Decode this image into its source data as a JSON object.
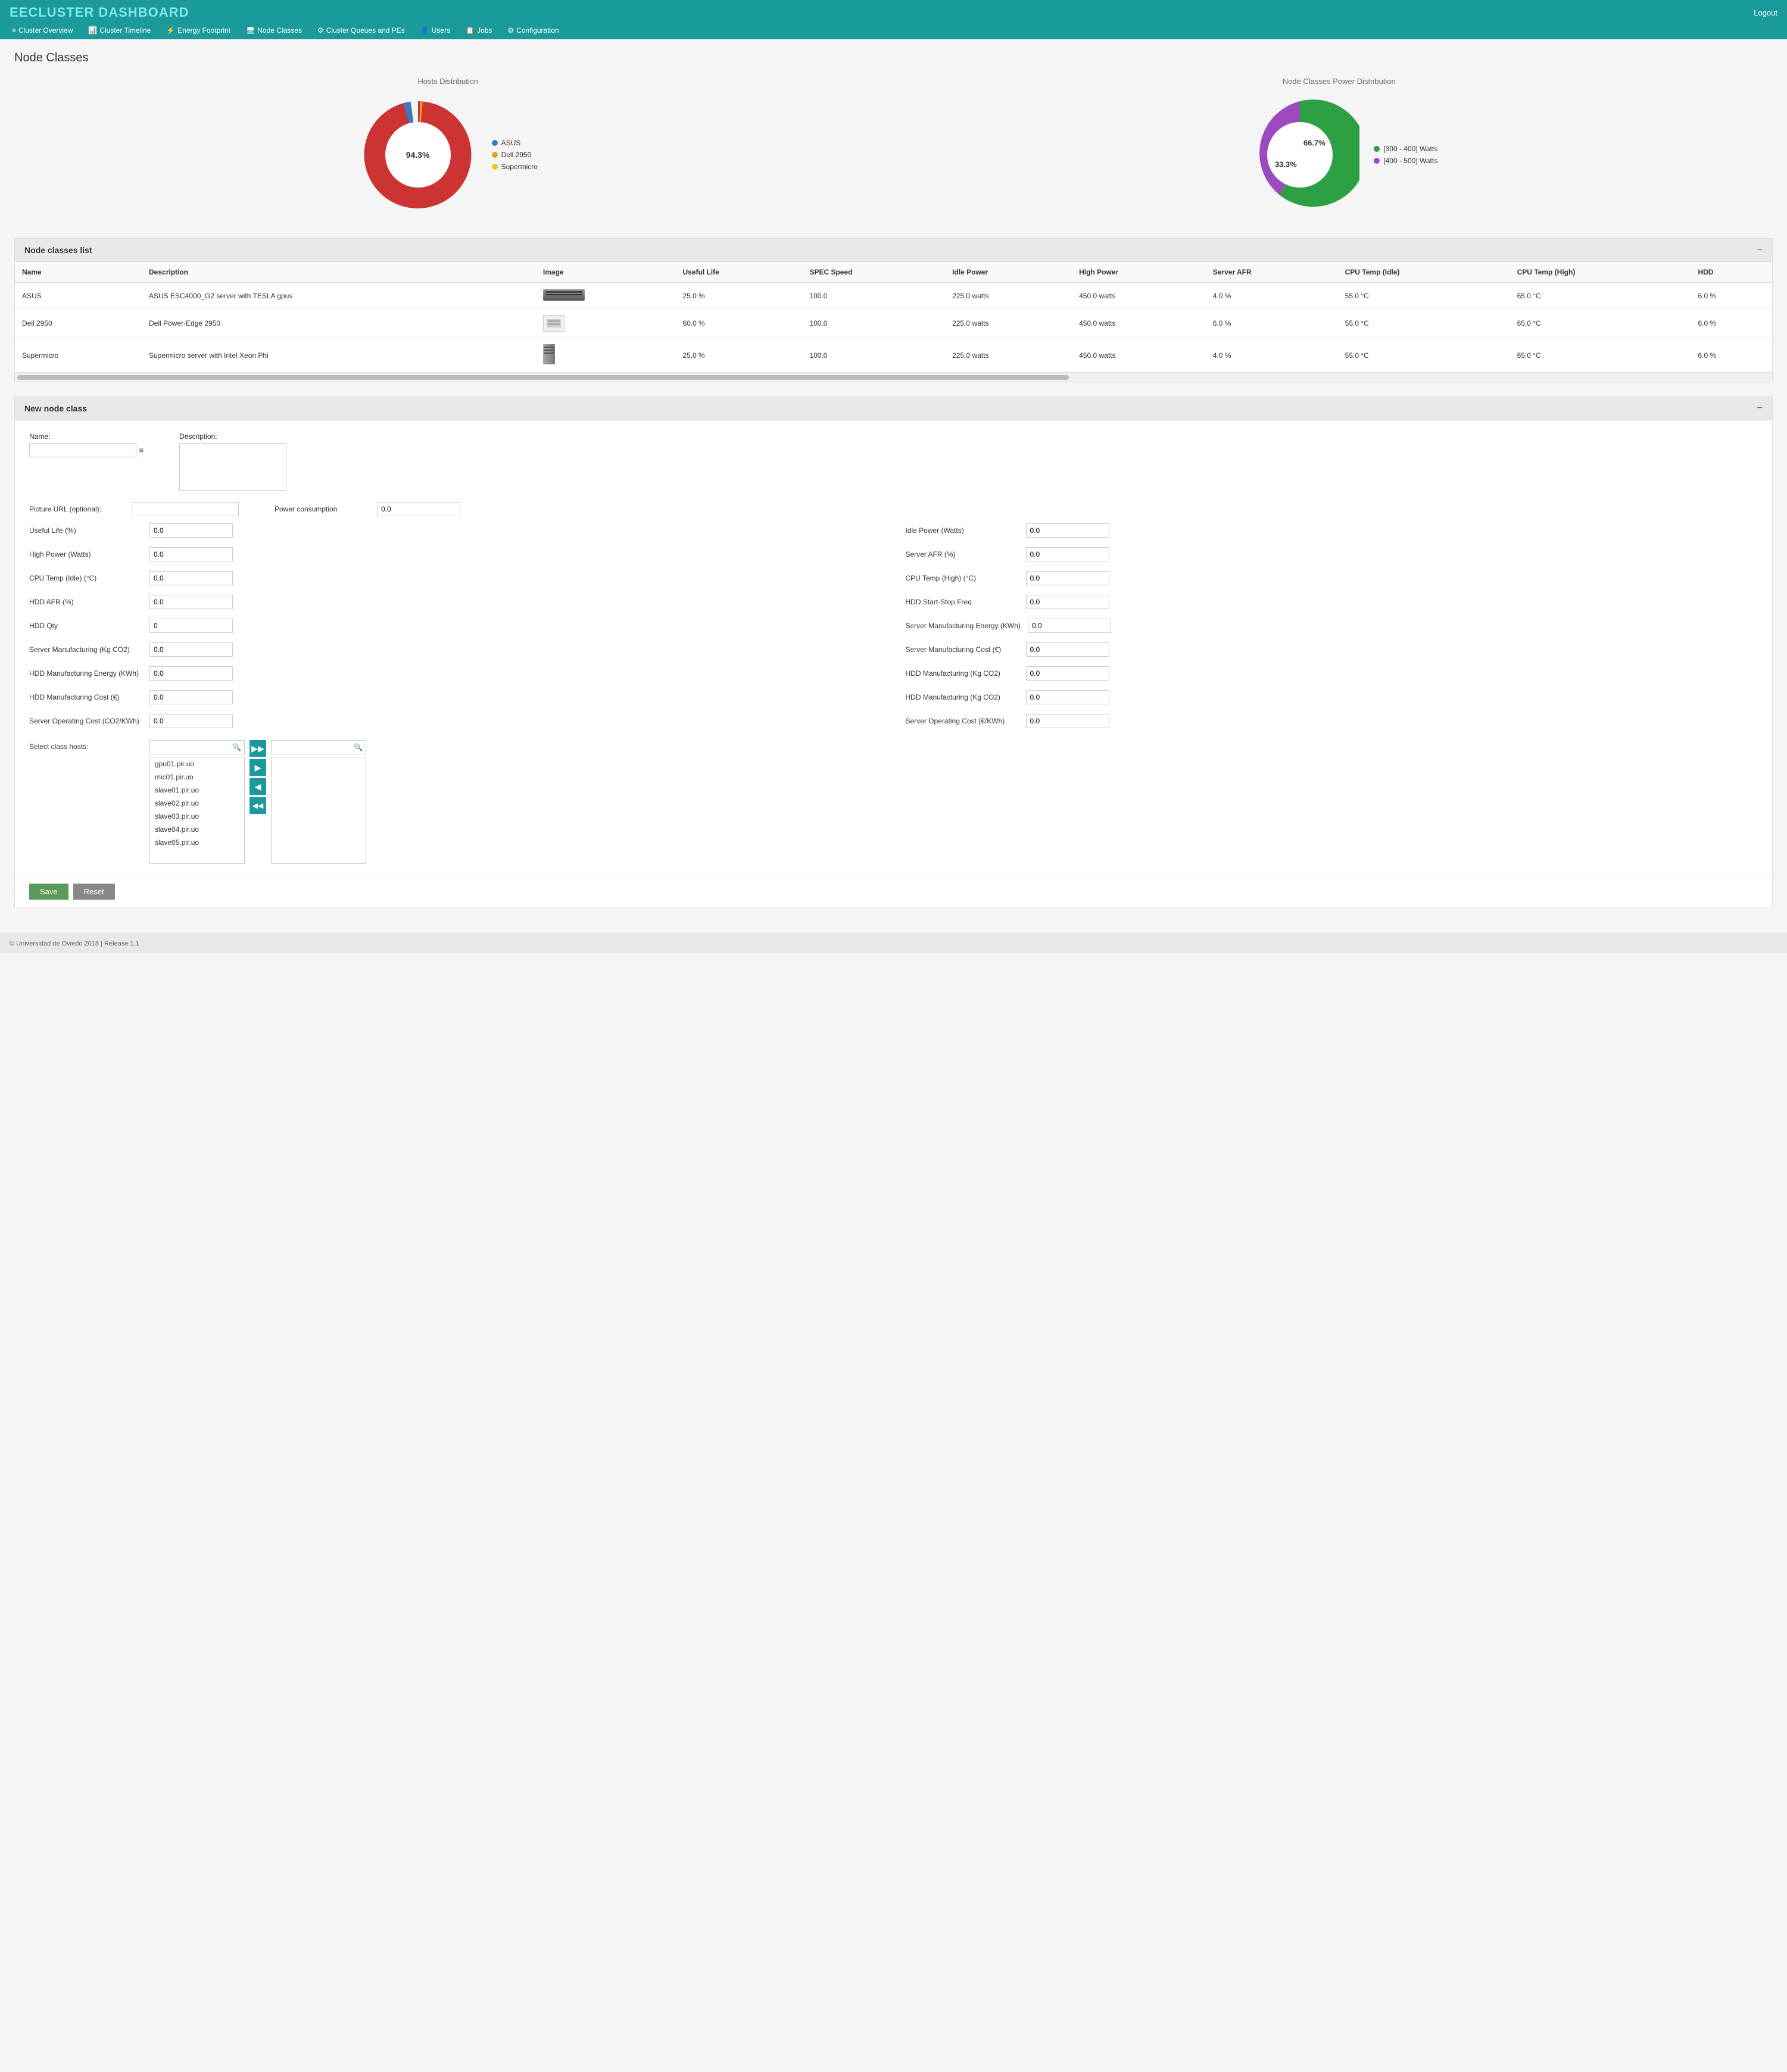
{
  "app": {
    "title_prefix": "EE",
    "title_main": "CLUSTER DASHBOARD",
    "logout_label": "Logout"
  },
  "nav": {
    "items": [
      {
        "id": "cluster-overview",
        "icon": "≡",
        "label": "Cluster Overview"
      },
      {
        "id": "cluster-timeline",
        "icon": "📊",
        "label": "Cluster Timeline"
      },
      {
        "id": "energy-footprint",
        "icon": "⚡",
        "label": "Energy Footprint"
      },
      {
        "id": "node-classes",
        "icon": "🖥",
        "label": "Node Classes"
      },
      {
        "id": "cluster-queues",
        "icon": "⚙",
        "label": "Cluster Queues and PEs"
      },
      {
        "id": "users",
        "icon": "👤",
        "label": "Users"
      },
      {
        "id": "jobs",
        "icon": "📋",
        "label": "Jobs"
      },
      {
        "id": "configuration",
        "icon": "⚙",
        "label": "Configuration"
      }
    ]
  },
  "page": {
    "title": "Node Classes"
  },
  "hosts_chart": {
    "title": "Hosts Distribution",
    "legend": [
      {
        "label": "ASUS",
        "color": "#3a7abf"
      },
      {
        "label": "Dell 2950",
        "color": "#e8a020"
      },
      {
        "label": "Supermicro",
        "color": "#e8c820"
      }
    ],
    "slices": [
      {
        "label": "ASUS",
        "percent": 94.3,
        "color": "#cc3333",
        "startAngle": 0,
        "endAngle": 339.48
      },
      {
        "label": "Dell 2950",
        "percent": 3.7,
        "color": "#3a7abf",
        "startAngle": 339.48,
        "endAngle": 352.8
      },
      {
        "label": "Supermicro",
        "percent": 2.0,
        "color": "#e8a020",
        "startAngle": 352.8,
        "endAngle": 360
      }
    ],
    "center_label": "94.3%"
  },
  "power_chart": {
    "title": "Node Classes Power Distribution",
    "legend": [
      {
        "label": "[300 - 400] Watts",
        "color": "#2da044"
      },
      {
        "label": "[400 - 500] Watts",
        "color": "#9b4ac0"
      }
    ],
    "slices": [
      {
        "label": "[300-400]",
        "percent": 66.7,
        "color": "#2da044"
      },
      {
        "label": "[400-500]",
        "percent": 33.3,
        "color": "#9b4ac0"
      }
    ],
    "label_300": "66.7%",
    "label_400": "33.3%"
  },
  "node_classes_table": {
    "section_title": "Node classes list",
    "collapse_icon": "−",
    "columns": [
      "Name",
      "Description",
      "Image",
      "Useful Life",
      "SPEC Speed",
      "Idle Power",
      "High Power",
      "Server AFR",
      "CPU Temp (Idle)",
      "CPU Temp (High)",
      "HDD"
    ],
    "rows": [
      {
        "name": "ASUS",
        "description": "ASUS ESC4000_G2 server with TESLA gpus",
        "image_type": "rack",
        "useful_life": "25.0 %",
        "spec_speed": "100.0",
        "idle_power": "225.0 watts",
        "high_power": "450.0 watts",
        "server_afr": "4.0 %",
        "cpu_temp_idle": "55.0 °C",
        "cpu_temp_high": "65.0 °C",
        "hdd": "6.0 %"
      },
      {
        "name": "Dell 2950",
        "description": "Dell Power-Edge 2950",
        "image_type": "small",
        "useful_life": "60.0 %",
        "spec_speed": "100.0",
        "idle_power": "225.0 watts",
        "high_power": "450.0 watts",
        "server_afr": "6.0 %",
        "cpu_temp_idle": "55.0 °C",
        "cpu_temp_high": "65.0 °C",
        "hdd": "6.0 %"
      },
      {
        "name": "Supermicro",
        "description": "Supermicro server with Intel Xeon Phi",
        "image_type": "tower",
        "useful_life": "25.0 %",
        "spec_speed": "100.0",
        "idle_power": "225.0 watts",
        "high_power": "450.0 watts",
        "server_afr": "4.0 %",
        "cpu_temp_idle": "55.0 °C",
        "cpu_temp_high": "65.0 °C",
        "hdd": "6.0 %"
      }
    ]
  },
  "new_node_class": {
    "section_title": "New node class",
    "collapse_icon": "−",
    "fields": {
      "name_label": "Name:",
      "description_label": "Description:",
      "picture_url_label": "Picture URL (optional):",
      "power_consumption_label": "Power consumption",
      "useful_life_label": "Useful Life (%)",
      "idle_power_label": "Idle Power (Watts)",
      "high_power_label": "High Power (Watts)",
      "server_afr_label": "Server AFR (%)",
      "cpu_temp_idle_label": "CPU Temp (Idle) (°C)",
      "cpu_temp_high_label": "CPU Temp (High) (°C)",
      "hdd_afr_label": "HDD AFR (%)",
      "hdd_start_stop_label": "HDD Start-Stop Freq",
      "hdd_qty_label": "HDD Qty",
      "server_mfg_energy_label": "Server Manufacturing Energy (KWh)",
      "server_mfg_co2_label": "Server Manufacturing (Kg CO2)",
      "server_mfg_cost_label": "Server Manufacturing Cost (€)",
      "hdd_mfg_energy_label": "HDD Manufacturing Energy (KWh)",
      "hdd_mfg_co2_label": "HDD Manufacturing (Kg CO2)",
      "hdd_mfg_cost_label": "HDD Manufacturing Cost (€)",
      "hdd_mfg_co2_right_label": "HDD Manufacturing (Kg CO2)",
      "server_op_cost_label": "Server Operating Cost (CO2/KWh)",
      "server_op_cost_right_label": "Server Operating Cost (€/KWh)",
      "select_hosts_label": "Select class hosts:",
      "name_value": "",
      "description_value": "",
      "picture_url_value": "",
      "power_consumption_value": "0.0",
      "useful_life_value": "0.0",
      "idle_power_value": "0.0",
      "high_power_value": "0.0",
      "server_afr_value": "0.0",
      "cpu_temp_idle_value": "0.0",
      "cpu_temp_high_value": "0.0",
      "hdd_afr_value": "0.0",
      "hdd_start_stop_value": "0.0",
      "hdd_qty_value": "0",
      "server_mfg_energy_value": "0.0",
      "server_mfg_co2_value": "0.0",
      "server_mfg_cost_value": "0.0",
      "hdd_mfg_energy_value": "0.0",
      "hdd_mfg_co2_value": "0.0",
      "hdd_mfg_cost_value": "0.0",
      "server_op_cost_value": "0.0",
      "server_op_cost_right_value": "0.0"
    },
    "available_hosts": [
      "gpu01.pir.uo",
      "mic01.pir.uo",
      "slave01.pir.uo",
      "slave02.pir.uo",
      "slave03.pir.uo",
      "slave04.pir.uo",
      "slave05.pir.uo"
    ],
    "save_label": "Save",
    "reset_label": "Reset"
  },
  "footer": {
    "text": "© Universidad de Oviedo 2018   |   Release 1.1"
  }
}
